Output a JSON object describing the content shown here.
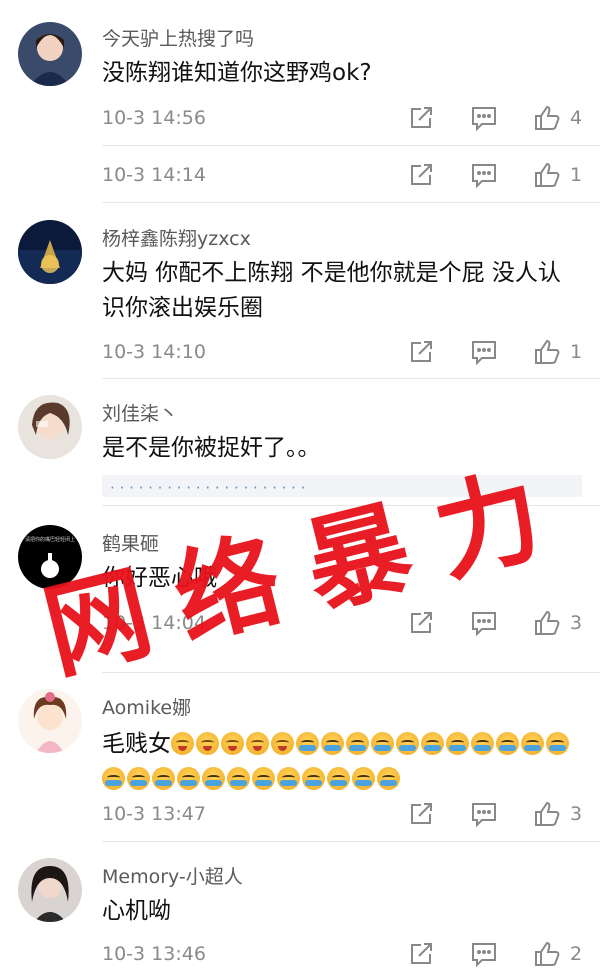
{
  "comments": [
    {
      "username": "今天驴上热搜了吗",
      "content": "没陈翔谁知道你这野鸡ok?",
      "time": "10-3 14:56",
      "likes": "4"
    },
    {
      "username": "",
      "content": "",
      "time": "10-3 14:14",
      "likes": "1"
    },
    {
      "username": "杨梓鑫陈翔yzxcx",
      "content": "大妈  你配不上陈翔  不是他你就是个屁  没人认识你滚出娱乐圈",
      "time": "10-3 14:10",
      "likes": "1"
    },
    {
      "username": "刘佳柒丶",
      "content": "是不是你被捉奸了。。",
      "time": "",
      "likes": ""
    },
    {
      "username": "鹤果砸",
      "content": "你好恶心哦",
      "time": "10-3 14:04",
      "likes": "3"
    },
    {
      "username": "Aomike娜",
      "content": "毛贱女",
      "time": "10-3 13:47",
      "likes": "3"
    },
    {
      "username": "Memory-小超人",
      "content": "心机呦",
      "time": "10-3 13:46",
      "likes": "2"
    }
  ],
  "quote_strip_text": "· · · · ·  · · · ·  · · · ·  · · · · ·  · · ·",
  "avatar_caption": "请把你的嘴巴轻轻闭上",
  "stamp_text": "网络暴力",
  "icons": {
    "share": "share-icon",
    "reply": "reply-icon",
    "like": "thumbs-up-icon"
  },
  "colors": {
    "stamp": "#e8111a",
    "meta": "#8a8a8a",
    "divider": "#e6e6e6"
  }
}
